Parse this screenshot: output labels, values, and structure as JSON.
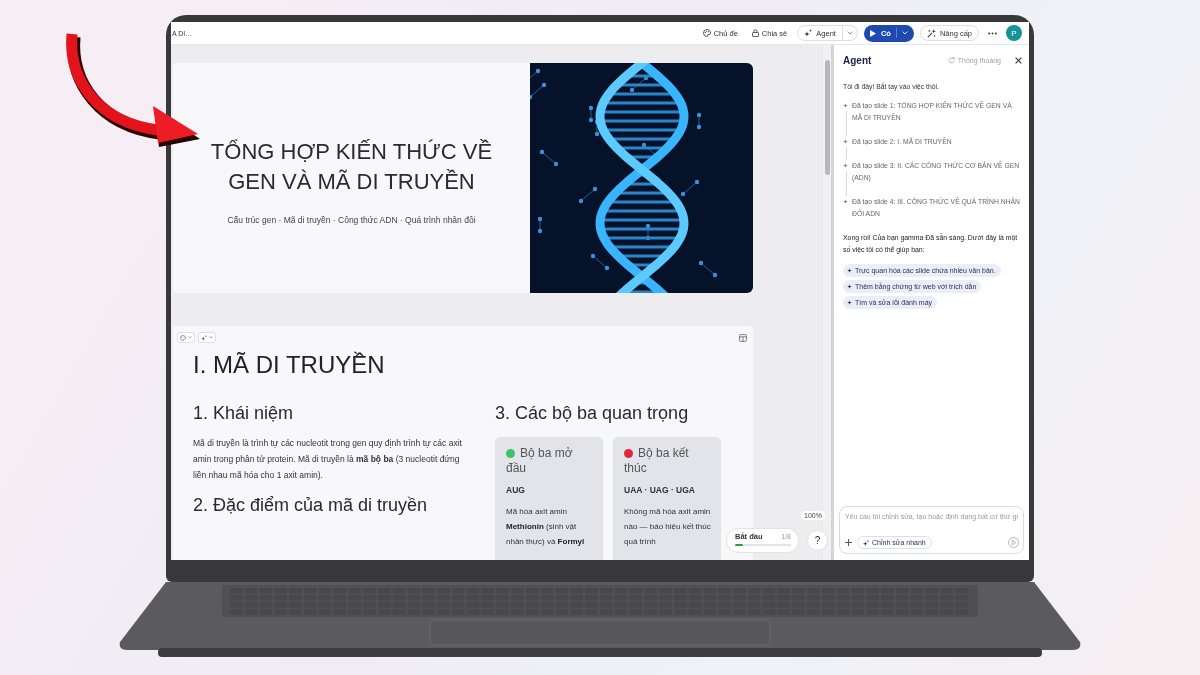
{
  "topbar": {
    "doc_title": "A DI…",
    "actions": [
      {
        "kind": "theme",
        "label": "Chủ đề"
      },
      {
        "kind": "share",
        "label": "Chia sẻ"
      },
      {
        "kind": "agent",
        "label": "Agent"
      },
      {
        "kind": "present",
        "label": "Có"
      },
      {
        "kind": "upgrade",
        "label": "Nâng cấp"
      },
      {
        "kind": "more"
      }
    ],
    "avatar": "P"
  },
  "title_slide": {
    "title": "TỔNG HỢP KIẾN THỨC VỀ GEN VÀ MÃ DI TRUYỀN",
    "subtitle": "Cấu trúc gen · Mã di truyền · Công thức ADN · Quá trình nhân đôi"
  },
  "content_slide": {
    "heading": "I. MÃ DI TRUYỀN",
    "left": [
      {
        "kind": "heading",
        "text": "1. Khái niệm"
      },
      {
        "kind": "paragraph",
        "text": "Mã di truyền là trình tự các nucleotit trong gen quy định trình tự các axit amin trong phân tử protein. Mã di truyền là **mã bộ ba** (3 nucleotit đứng liền nhau mã hóa cho 1 axit amin)."
      },
      {
        "kind": "heading",
        "text": "2. Đặc điểm của mã di truyền"
      }
    ],
    "right_heading": "3. Các bộ ba quan trọng",
    "cards": [
      {
        "color": "#3cc46c",
        "title": "Bộ ba mở đầu",
        "code": "AUG",
        "text": "Mã hóa axit amin **Methionin** (sinh vật nhân thực) và **Formyl**"
      },
      {
        "color": "#e3263a",
        "title": "Bộ ba kết thúc",
        "code": "UAA · UAG · UGA",
        "text": "Không mã hóa axit amin nào — báo hiệu kết thúc quá trình"
      }
    ]
  },
  "progress": {
    "label": "Bắt đầu",
    "count": "1/8",
    "level": 0.15
  },
  "zoom": "100%",
  "help": "?",
  "agent": {
    "title": "Agent",
    "refresh_label": "Thông thoáng",
    "greeting": "Tôi đi đây! Bắt tay vào việc thôi.",
    "steps": [
      "Đã tạo slide 1: TỔNG HỢP KIẾN THỨC VỀ GEN VÀ MÃ DI TRUYỀN",
      "Đã tạo slide 2: I. MÃ DI TRUYỀN",
      "Đã tạo slide 3: II. CÁC CÔNG THỨC CƠ BẢN VỀ GEN (ADN)",
      "Đã tạo slide 4: III. CÔNG THỨC VỀ QUÁ TRÌNH NHÂN ĐÔI ADN"
    ],
    "summary": "Xong rồi! Của bạn gamma Đã sẵn sàng. Dưới đây là một số việc tôi có thể giúp bạn:",
    "suggestions": [
      "Trực quan hóa các slide chứa nhiều văn bản.",
      "Thêm bằng chứng từ web với trích dẫn",
      "Tìm và sửa lỗi đánh máy"
    ],
    "input": {
      "placeholder": "Yêu cầu tôi chỉnh sửa, tạo hoặc định dạng bất cứ thứ gì"
    },
    "quick_edit": "Chỉnh sửa nhanh"
  }
}
